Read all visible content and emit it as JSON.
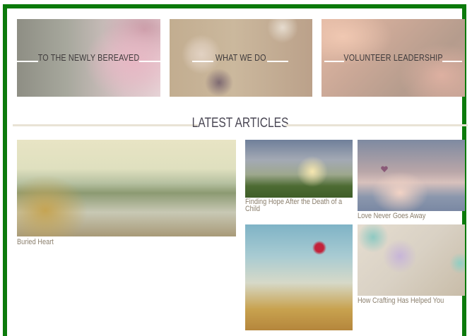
{
  "tiles": [
    {
      "label": "TO THE NEWLY BEREAVED"
    },
    {
      "label": "WHAT WE DO"
    },
    {
      "label": "VOLUNTEER LEADERSHIP"
    }
  ],
  "latest": {
    "title": "LATEST ARTICLES"
  },
  "articles": [
    {
      "title": "Buried Heart"
    },
    {
      "title": "Finding Hope After the Death of a Child"
    },
    {
      "title": "Love Never Goes Away"
    },
    {
      "title": ""
    },
    {
      "title": "How Crafting Has Helped You"
    }
  ],
  "colors": {
    "frame": "#0b7a0b",
    "caption": "#8b7f6d",
    "heading": "#4a4754",
    "divider": "#e9e3d5"
  }
}
